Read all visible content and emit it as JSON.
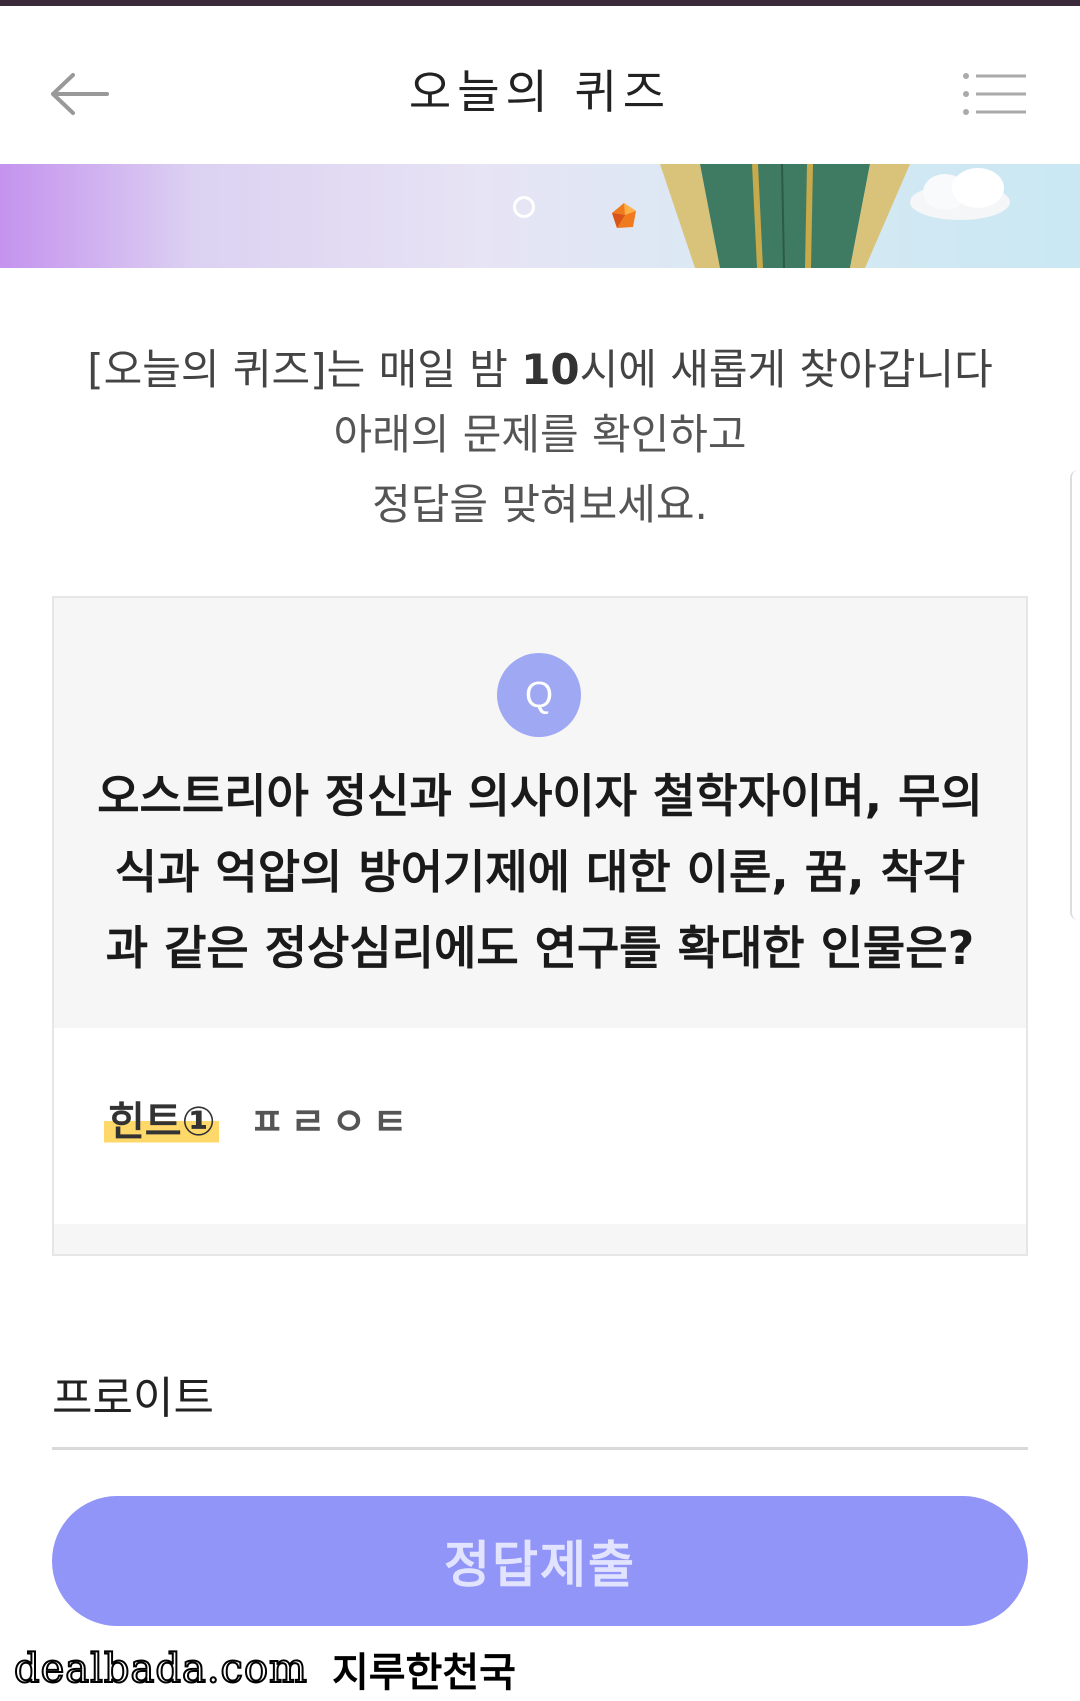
{
  "header": {
    "title": "오늘의 퀴즈",
    "back_icon": "back-arrow-icon",
    "menu_icon": "list-menu-icon"
  },
  "intro": {
    "line1_prefix": "[오늘의 퀴즈]는 매일 밤 ",
    "line1_bold": "10",
    "line1_suffix": "시에 새롭게 찾아갑니다",
    "line2": "아래의 문제를 확인하고",
    "line3": "정답을 맞혀보세요."
  },
  "quiz": {
    "badge": "Q",
    "question": "오스트리아 정신과 의사이자 철학자이며, 무의식과 억압의 방어기제에 대한 이론, 꿈, 착각과 같은 정상심리에도 연구를 확대한 인물은?",
    "hint_label": "힌트①",
    "hint_text": "ㅍㄹㅇㅌ"
  },
  "answer": {
    "value": "프로이트"
  },
  "submit": {
    "label": "정답제출"
  },
  "watermark": {
    "site": "dealbada.com",
    "name": "지루한천국"
  },
  "colors": {
    "accent": "#9095f7",
    "badge": "#9fa8f2",
    "hint_highlight": "#ffd86a"
  }
}
